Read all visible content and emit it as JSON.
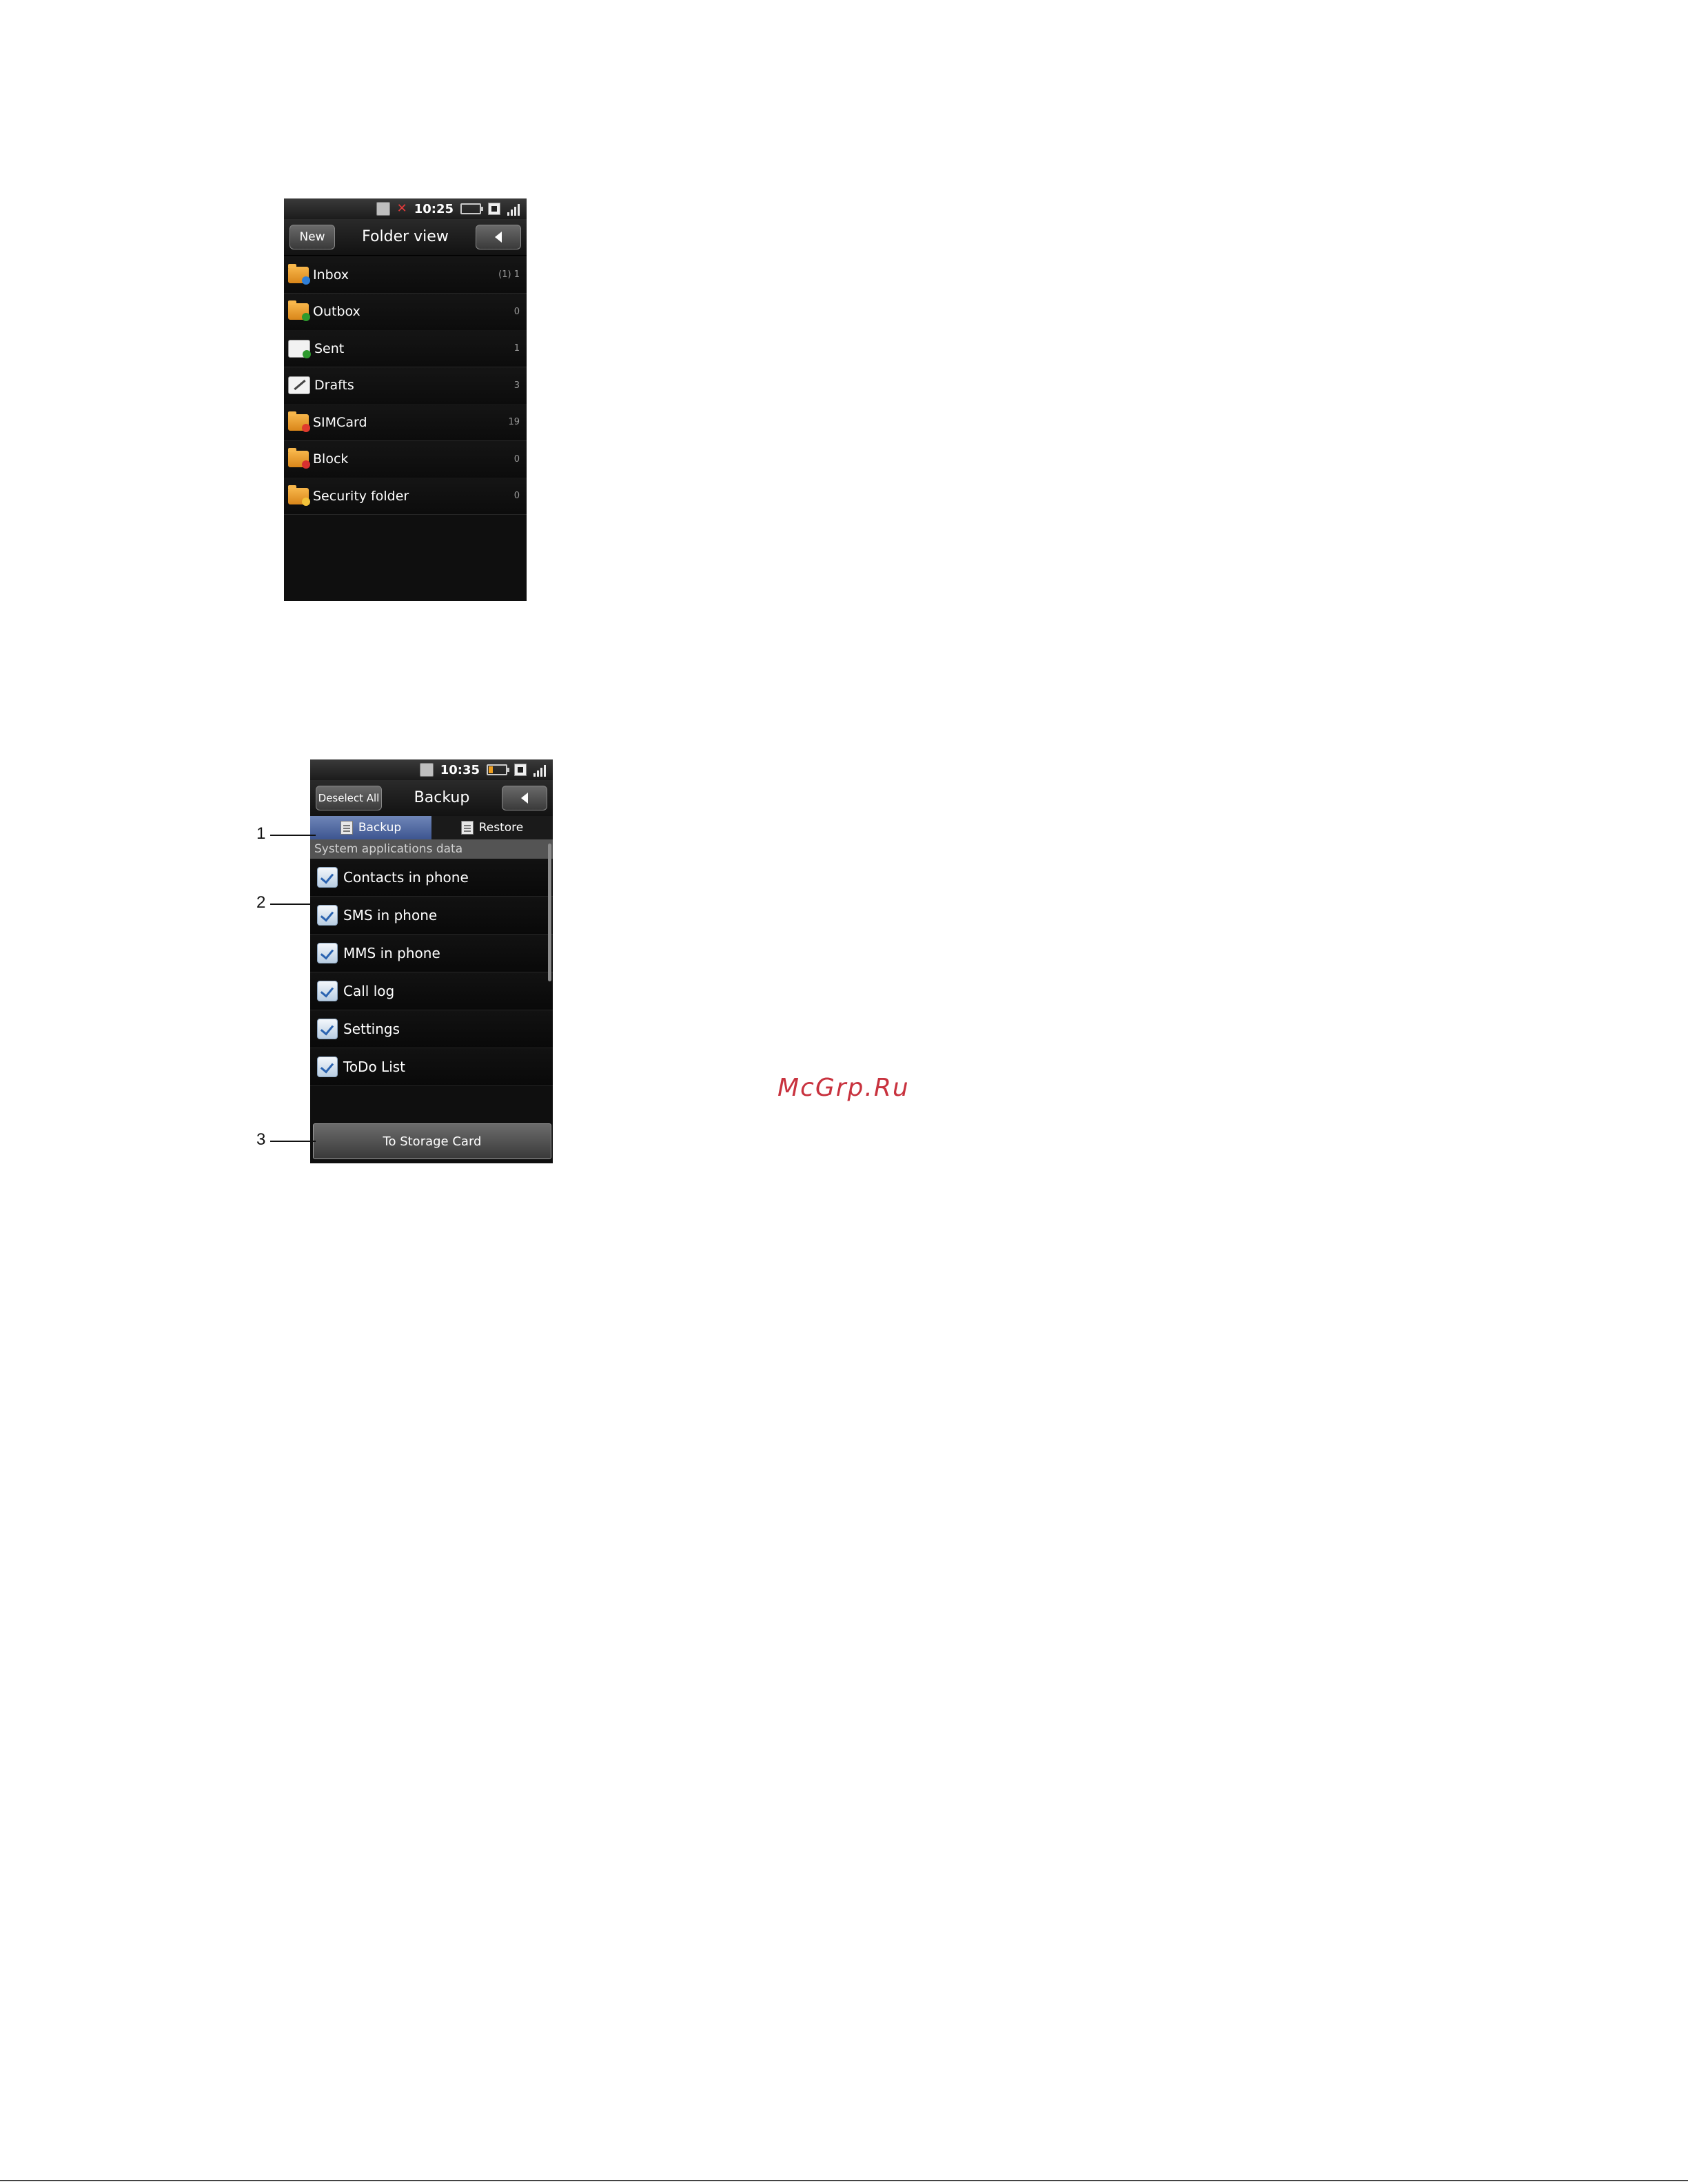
{
  "folder_screen": {
    "status": {
      "time": "10:25"
    },
    "title": "Folder view",
    "new_label": "New",
    "folders": [
      {
        "name": "Inbox",
        "count": "(1) 1",
        "icon": "inbox-folder-icon"
      },
      {
        "name": "Outbox",
        "count": "0",
        "icon": "outbox-folder-icon"
      },
      {
        "name": "Sent",
        "count": "1",
        "icon": "sent-envelope-icon"
      },
      {
        "name": "Drafts",
        "count": "3",
        "icon": "drafts-pencil-icon"
      },
      {
        "name": "SIMCard",
        "count": "19",
        "icon": "simcard-folder-icon"
      },
      {
        "name": "Block",
        "count": "0",
        "icon": "block-folder-icon"
      },
      {
        "name": "Security folder",
        "count": "0",
        "icon": "security-folder-icon"
      }
    ]
  },
  "backup_screen": {
    "status": {
      "time": "10:35"
    },
    "title": "Backup",
    "deselect_label": "Deselect All",
    "tabs": [
      {
        "label": "Backup",
        "active": true
      },
      {
        "label": "Restore",
        "active": false
      }
    ],
    "section_header": "System applications data",
    "items": [
      {
        "label": "Contacts in phone",
        "checked": true
      },
      {
        "label": "SMS in phone",
        "checked": true
      },
      {
        "label": "MMS in phone",
        "checked": true
      },
      {
        "label": "Call log",
        "checked": true
      },
      {
        "label": "Settings",
        "checked": true
      },
      {
        "label": "ToDo List",
        "checked": true
      }
    ],
    "storage_button": "To Storage Card"
  },
  "callouts": [
    "1",
    "2",
    "3"
  ],
  "watermark": "McGrp.Ru"
}
